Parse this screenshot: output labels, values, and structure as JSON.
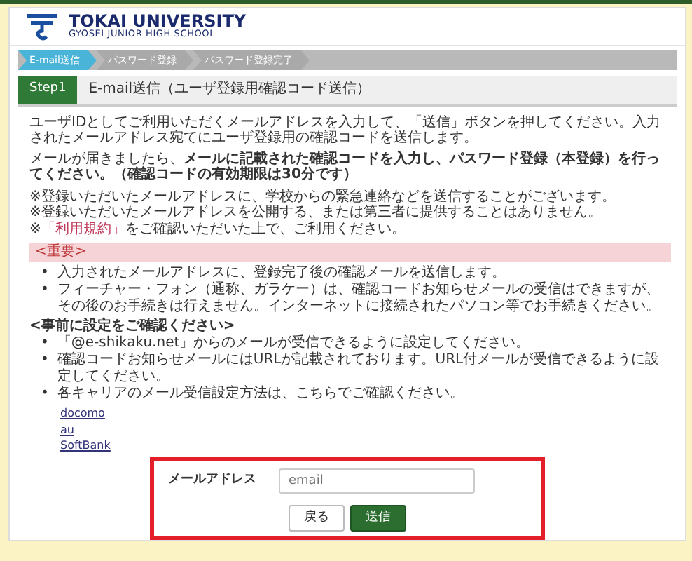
{
  "logo": {
    "name": "TOKAI UNIVERSITY",
    "subtitle": "GYOSEI JUNIOR HIGH SCHOOL"
  },
  "steps": [
    {
      "label": "E-mail送信",
      "selected": true
    },
    {
      "label": "パスワード登録",
      "selected": false
    },
    {
      "label": "パスワード登録完了",
      "selected": false
    }
  ],
  "step_header": {
    "badge": "Step1",
    "title": "E-mail送信（ユーザ登録用確認コード送信）"
  },
  "intro": [
    "ユーザIDとしてご利用いただくメールアドレスを入力して、「送信」ボタンを押してください。入力されたメールアドレス宛てにユーザ登録用の確認コードを送信します。",
    "メールが届きましたら、**メールに記載された確認コードを入力し、パスワード登録（本登録）を行ってください。（確認コードの有効期限は30分です）**"
  ],
  "notes": [
    {
      "text": "※登録いただいたメールアドレスに、学校からの緊急連絡などを送信することがございます。"
    },
    {
      "text": "※登録いただいたメールアドレスを公開する、または第三者に提供することはありません。"
    },
    {
      "prefix": "※",
      "link": "「利用規約」",
      "text": "をご確認いただいた上で、ご利用ください。"
    }
  ],
  "important": {
    "heading": "<重要>",
    "marker": "•",
    "items": [
      "入力されたメールアドレスに、登録完了後の確認メールを送信します。",
      "フィーチャー・フォン（通称、ガラケー）は、確認コードお知らせメールの受信はできますが、その後のお手続きは行えません。インターネットに接続されたパソコン等でお手続きください。"
    ]
  },
  "settings": {
    "heading": "<事前に設定をご確認ください>",
    "marker": "•",
    "items": [
      "「@e-shikaku.net」からのメールが受信できるように設定してください。",
      "確認コードお知らせメールにはURLが記載されております。URL付メールが受信できるように設定してください。",
      "各キャリアのメール受信設定方法は、こちらでご確認ください。"
    ],
    "links": [
      "docomo",
      "au",
      "SoftBank"
    ]
  },
  "form": {
    "label": "メールアドレス",
    "placeholder": "email",
    "highlighted": true
  },
  "buttons": [
    {
      "label": "戻る",
      "kind": "secondary"
    },
    {
      "label": "送信",
      "kind": "primary"
    }
  ]
}
